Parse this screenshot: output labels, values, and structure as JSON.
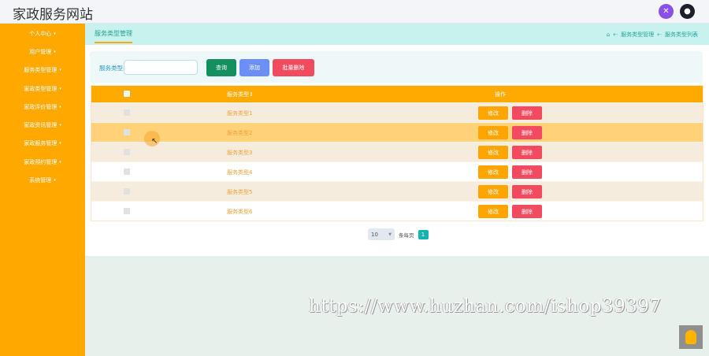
{
  "header": {
    "title": "家政服务网站"
  },
  "sidebar": {
    "items": [
      {
        "label": "个人中心"
      },
      {
        "label": "用户管理"
      },
      {
        "label": "服务类型管理"
      },
      {
        "label": "家政类型管理"
      },
      {
        "label": "家政评价管理"
      },
      {
        "label": "家政资讯管理"
      },
      {
        "label": "家政服务管理"
      },
      {
        "label": "家政预约管理"
      },
      {
        "label": "系统管理"
      }
    ]
  },
  "tabs": {
    "active": "服务类型管理"
  },
  "breadcrumb": {
    "item1": "服务类型管理",
    "item2": "服务类型列表"
  },
  "search": {
    "label": "服务类型",
    "value": "",
    "placeholder": ""
  },
  "buttons": {
    "query": "查询",
    "add": "添加",
    "batch_delete": "批量删除"
  },
  "table": {
    "columns": {
      "name": "服务类型",
      "actions": "操作"
    },
    "edit_label": "修改",
    "delete_label": "删除",
    "rows": [
      {
        "name": "服务类型1"
      },
      {
        "name": "服务类型2"
      },
      {
        "name": "服务类型3"
      },
      {
        "name": "服务类型4"
      },
      {
        "name": "服务类型5"
      },
      {
        "name": "服务类型6"
      }
    ]
  },
  "pagination": {
    "page_size": "10",
    "label": "条每页",
    "current_page": "1"
  },
  "watermark": "https://www.huzhan.com/ishop39397",
  "colors": {
    "sidebar": "#ffa800",
    "table_header": "#ffaa00",
    "accent": "#15b3b0"
  }
}
